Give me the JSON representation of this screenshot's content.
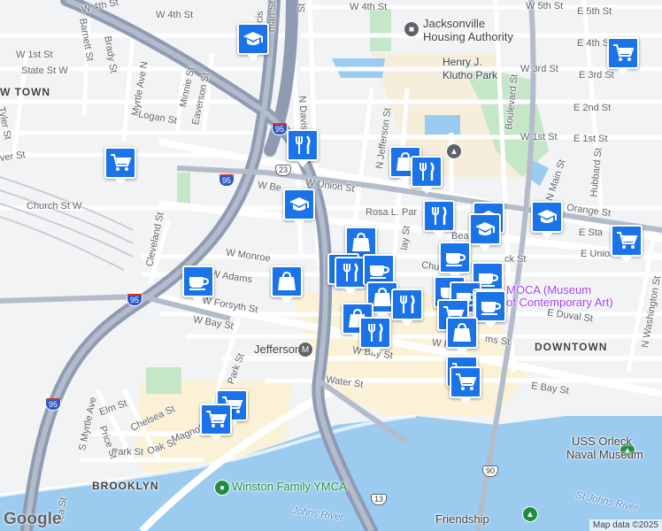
{
  "map": {
    "attribution": "Map data ©2025",
    "logo": "Google"
  },
  "colors": {
    "marker": "#1a73e8",
    "highway": "#8f9bb3",
    "water": "#9ccbf0",
    "park": "#c6e6c8"
  },
  "areas": {
    "new_town": "W TOWN",
    "downtown": "DOWNTOWN",
    "brooklyn": "BROOKLYN"
  },
  "pois": {
    "housing_authority_1": "Jacksonville",
    "housing_authority_2": "Housing Authority",
    "klutho_1": "Henry J.",
    "klutho_2": "Klutho Park",
    "moca_1": "MOCA (Museum",
    "moca_2": "of Contemporary Art)",
    "orleck_1": "USS Orleck",
    "orleck_2": "Naval Museum",
    "ymca": "Winston Family YMCA",
    "jefferson": "Jefferson",
    "friendship": "Friendship",
    "st_johns_river": "St Johns River",
    "johns_river": "Johns River"
  },
  "streets": {
    "w_4th": "W 4th St",
    "w_4th_b": "W 4th St",
    "w_4th_c": "W 4th St",
    "w_5th": "W 5th St",
    "e_5th": "E 5th St",
    "e_4th": "E 4th St",
    "w_3rd": "W 3rd St",
    "e_3rd": "E 3rd St",
    "e_2nd": "E 2nd St",
    "w_1st": "W 1st St",
    "e_1st": "E 1st St",
    "w_union": "W Union St",
    "w_beaver": "W Be",
    "rosa_parks": "Rosa L. Par",
    "beaver": "Beav",
    "e_state": "E Sta",
    "e_union": "E Union",
    "orange": "Orange St",
    "w_monroe": "W Monroe",
    "w_adams": "W Adams",
    "w_forsyth": "W Forsyth St",
    "w_bay": "W Bay St",
    "w_bay_b": "W Bay St",
    "w_forsyth_b": "W Fo",
    "water": "Water St",
    "e_bay": "E Bay St",
    "e_duval": "E Duval St",
    "church": "Church St W",
    "chur": "Church",
    "w_st": "W 1st St",
    "state": "State St W",
    "tyler": "Tyler St",
    "barnett": "Barnett St",
    "brady": "Brady St",
    "myrtle": "Myrtle Ave N",
    "minnie": "Minnie St",
    "eaverson": "Eaverson St",
    "logan": "Logan St",
    "ver": "ver St",
    "n_davis": "N Davis",
    "n_jefferson": "N Jefferson St",
    "boulevard": "Boulevard St",
    "n_main": "N Main St",
    "hubbard": "Hubbard St",
    "n_washington": "N Washington St",
    "cleveland": "Cleveland St",
    "park": "Park St",
    "park_b": "Park St",
    "elm": "Elm St",
    "chelsea": "Chelsea St",
    "price": "Price St",
    "s_myrtle": "S Myrtle Ave",
    "oak": "Oak St",
    "magnolia": "Magnolia",
    "sea": "sea St",
    "lay": "lay St",
    "ancis": "ancis",
    "man": "man St",
    "ms": "ms St",
    "ck_st": "ck St",
    "s_t": "St"
  },
  "shields": {
    "i95_a": "95",
    "i95_b": "95",
    "i95_c": "95",
    "i95_d": "95",
    "us23": "23",
    "us90": "90",
    "us13": "13"
  },
  "markers": [
    {
      "type": "school",
      "label": "school-marker"
    },
    {
      "type": "cart",
      "label": "cart-marker"
    },
    {
      "type": "cart",
      "label": "cart-marker"
    },
    {
      "type": "restaurant",
      "label": "restaurant-marker"
    },
    {
      "type": "bag",
      "label": "bag-marker"
    },
    {
      "type": "restaurant",
      "label": "restaurant-marker"
    },
    {
      "type": "school",
      "label": "school-marker"
    },
    {
      "type": "restaurant",
      "label": "restaurant-marker"
    },
    {
      "type": "cafe",
      "label": "cafe-marker"
    },
    {
      "type": "school",
      "label": "school-marker"
    },
    {
      "type": "school",
      "label": "school-marker"
    },
    {
      "type": "school",
      "label": "school-marker"
    },
    {
      "type": "cart",
      "label": "cart-marker"
    },
    {
      "type": "bag",
      "label": "bag-marker"
    },
    {
      "type": "restaurant",
      "label": "restaurant-marker"
    },
    {
      "type": "restaurant",
      "label": "restaurant-marker"
    },
    {
      "type": "cafe",
      "label": "cafe-marker"
    },
    {
      "type": "cafe",
      "label": "cafe-marker"
    },
    {
      "type": "bag",
      "label": "bag-marker"
    },
    {
      "type": "cafe",
      "label": "cafe-marker"
    },
    {
      "type": "bag",
      "label": "bag-marker"
    },
    {
      "type": "cafe",
      "label": "cafe-marker"
    },
    {
      "type": "cafe",
      "label": "cafe-marker"
    },
    {
      "type": "cafe",
      "label": "cafe-marker"
    },
    {
      "type": "restaurant",
      "label": "restaurant-marker"
    },
    {
      "type": "cart",
      "label": "cart-marker"
    },
    {
      "type": "cafe",
      "label": "cafe-marker"
    },
    {
      "type": "bag",
      "label": "bag-marker"
    },
    {
      "type": "restaurant",
      "label": "restaurant-marker"
    },
    {
      "type": "bag",
      "label": "bag-marker"
    },
    {
      "type": "cart",
      "label": "cart-marker"
    },
    {
      "type": "cart",
      "label": "cart-marker"
    },
    {
      "type": "cart",
      "label": "cart-marker"
    },
    {
      "type": "cart",
      "label": "cart-marker"
    }
  ]
}
